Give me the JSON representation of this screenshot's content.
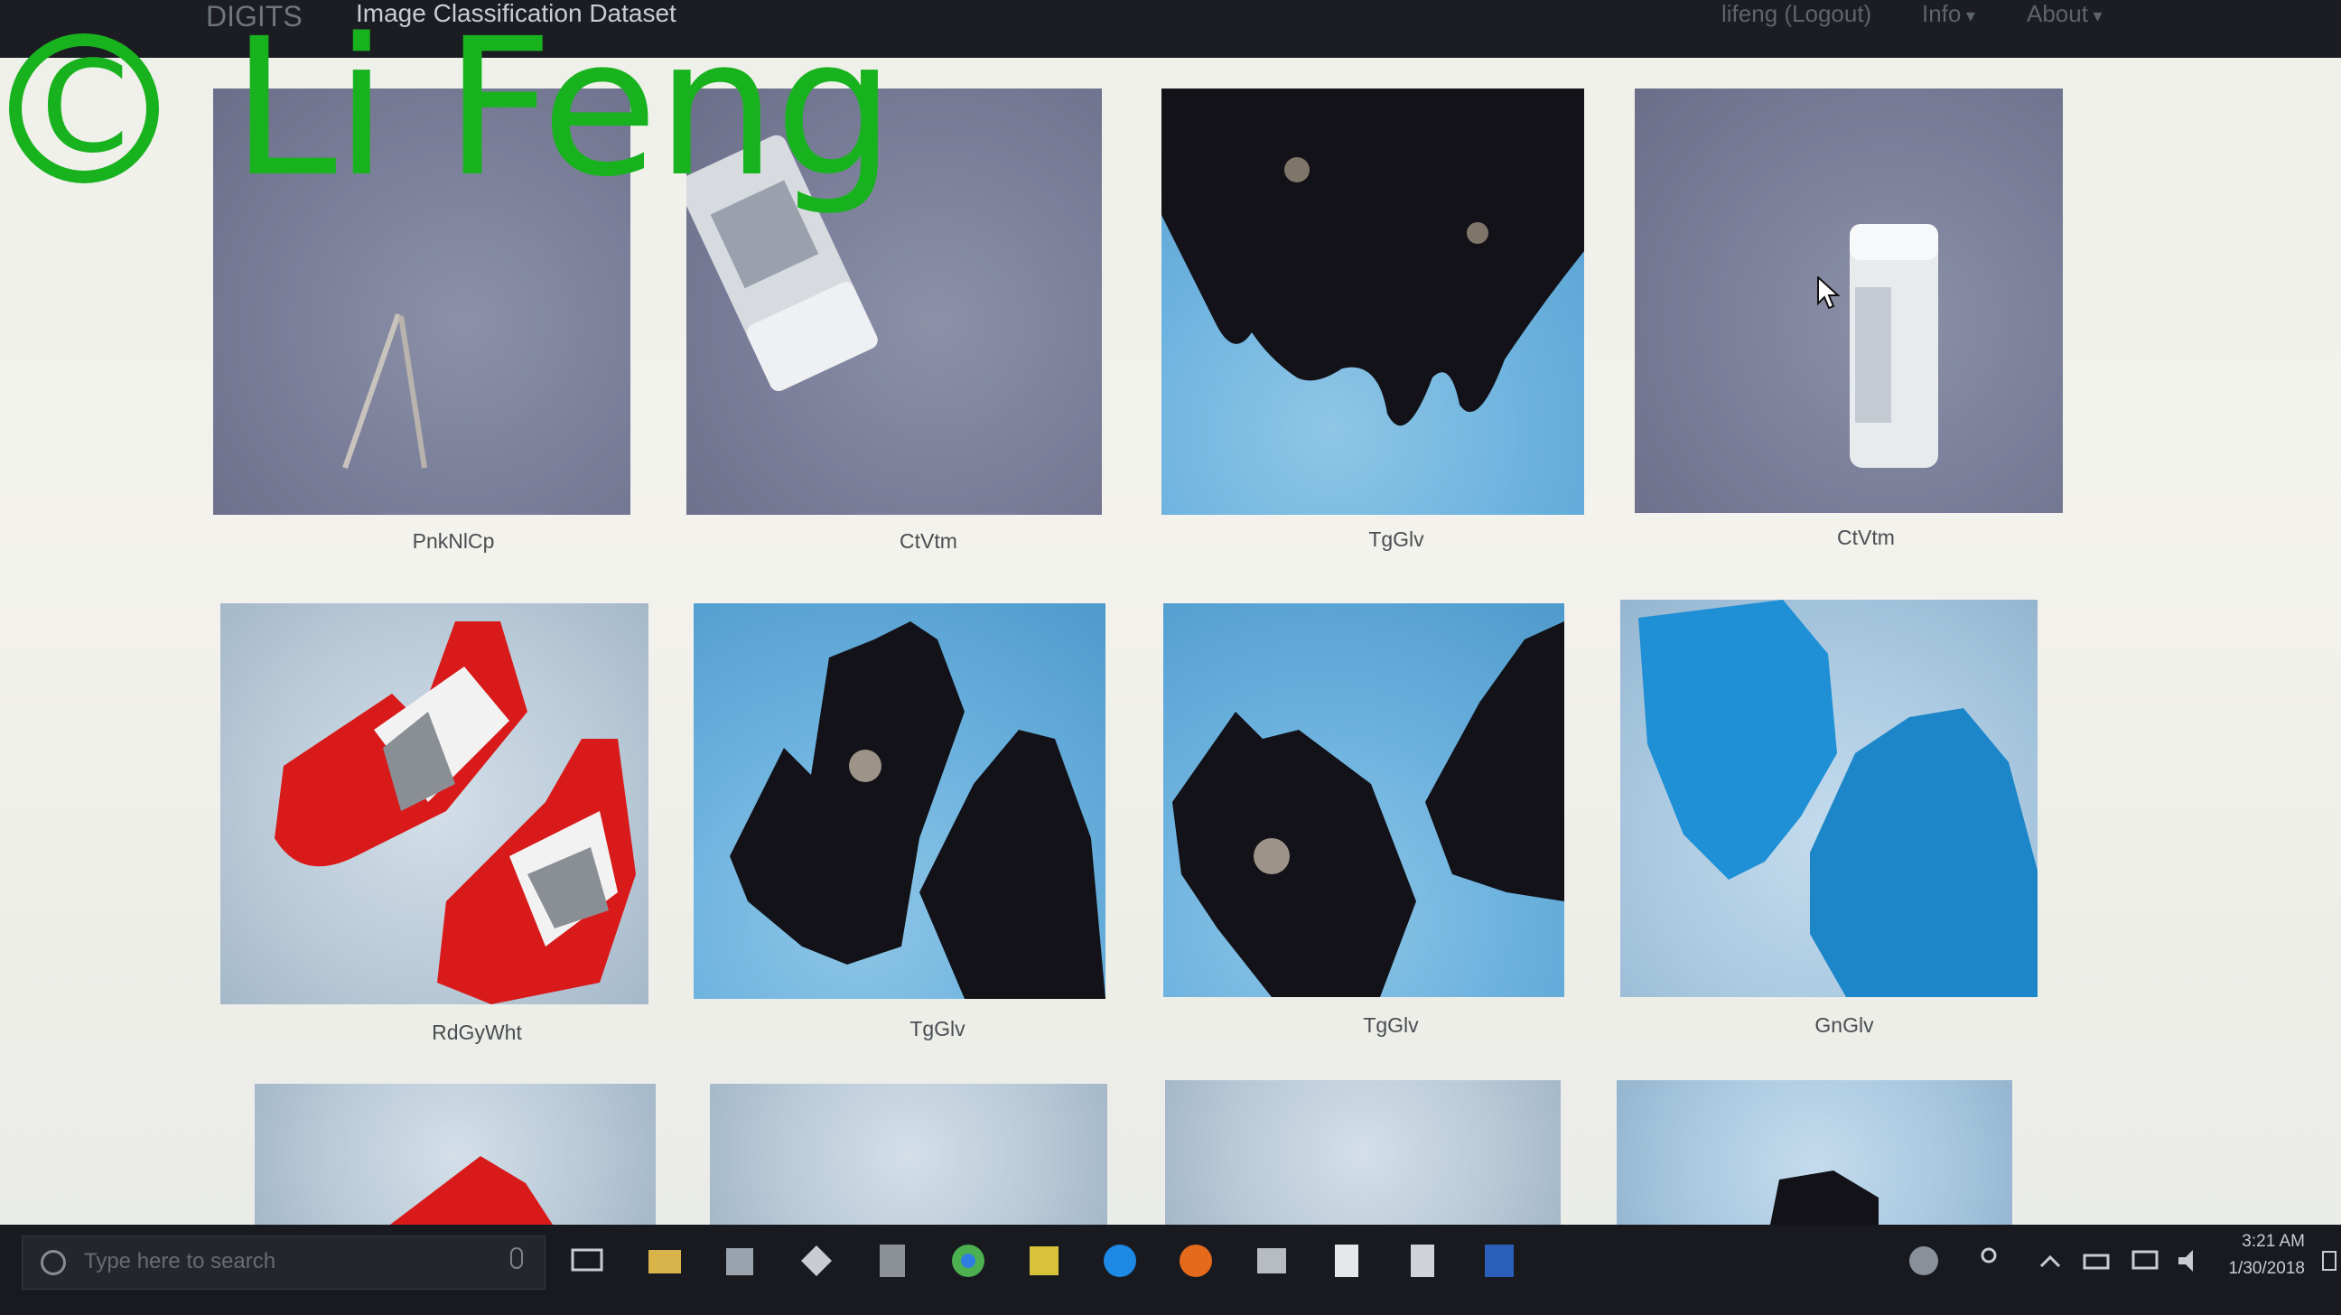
{
  "navbar": {
    "brand": "DIGITS",
    "title": "Image Classification Dataset",
    "user": "lifeng (Logout)",
    "info": "Info",
    "about": "About"
  },
  "watermark": {
    "symbol": "C",
    "text": "Li Feng",
    "color": "#19b21f"
  },
  "grid": {
    "row1": [
      "PnkNlCp",
      "CtVtm",
      "TgGlv",
      "CtVtm"
    ],
    "row2": [
      "RdGyWht",
      "TgGlv",
      "TgGlv",
      "GnGlv"
    ]
  },
  "taskbar": {
    "search_placeholder": "Type here to search",
    "time": "3:21 AM",
    "date": "1/30/2018",
    "apps": [
      "task-view-icon",
      "file-explorer-icon",
      "folder-icon",
      "git-icon",
      "calculator-icon",
      "chrome-icon",
      "app-icon",
      "edge-icon",
      "firefox-icon",
      "image-icon",
      "document-icon",
      "notepad-icon",
      "word-icon"
    ]
  }
}
